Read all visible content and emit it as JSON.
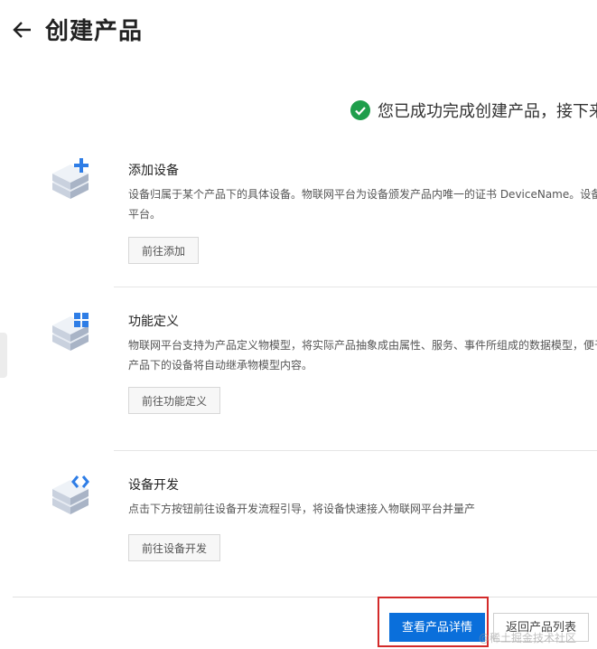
{
  "header": {
    "title": "创建产品",
    "back_icon": "arrow-left-icon"
  },
  "success": {
    "text": "您已成功完成创建产品，接下来",
    "icon": "check-circle-icon",
    "color": "#1e9e4b"
  },
  "steps": [
    {
      "title": "添加设备",
      "desc_lines": [
        "设备归属于某个产品下的具体设备。物联网平台为设备颁发产品内唯一的证书 DeviceName。设备",
        "平台。"
      ],
      "button": "前往添加",
      "icon": "add-device-icon"
    },
    {
      "title": "功能定义",
      "desc_lines": [
        "物联网平台支持为产品定义物模型，将实际产品抽象成由属性、服务、事件所组成的数据模型，便于",
        "产品下的设备将自动继承物模型内容。"
      ],
      "button": "前往功能定义",
      "icon": "function-define-icon"
    },
    {
      "title": "设备开发",
      "desc_lines": [
        "点击下方按钮前往设备开发流程引导，将设备快速接入物联网平台并量产"
      ],
      "button": "前往设备开发",
      "icon": "device-dev-icon"
    }
  ],
  "footer": {
    "primary": "查看产品详情",
    "secondary": "返回产品列表"
  },
  "watermark": "@稀土掘金技术社区",
  "colors": {
    "primary": "#0a6fdb",
    "highlight": "#d32a2a",
    "icon_blue": "#2e7de6",
    "success": "#1e9e4b"
  }
}
